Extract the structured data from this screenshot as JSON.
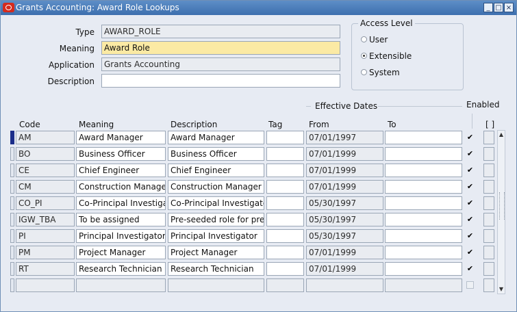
{
  "window": {
    "title": "Grants Accounting: Award Role Lookups",
    "min_label": "_",
    "max_label": "□",
    "close_label": "×"
  },
  "header": {
    "type_label": "Type",
    "type_value": "AWARD_ROLE",
    "meaning_label": "Meaning",
    "meaning_value": "Award Role",
    "application_label": "Application",
    "application_value": "Grants Accounting",
    "description_label": "Description",
    "description_value": ""
  },
  "access_level": {
    "label": "Access Level",
    "options": [
      {
        "label": "User",
        "selected": false
      },
      {
        "label": "Extensible",
        "selected": true
      },
      {
        "label": "System",
        "selected": false
      }
    ]
  },
  "table": {
    "effective_dates_label": "Effective Dates",
    "enabled_label": "Enabled",
    "bracket_label": "[ ]",
    "headers": {
      "code": "Code",
      "meaning": "Meaning",
      "description": "Description",
      "tag": "Tag",
      "from": "From",
      "to": "To"
    },
    "rows": [
      {
        "code": "AM",
        "meaning": "Award Manager",
        "description": "Award Manager",
        "tag": "",
        "from": "07/01/1997",
        "to": "",
        "enabled": true
      },
      {
        "code": "BO",
        "meaning": "Business Officer",
        "description": "Business Officer",
        "tag": "",
        "from": "07/01/1999",
        "to": "",
        "enabled": true
      },
      {
        "code": "CE",
        "meaning": "Chief Engineer",
        "description": "Chief Engineer",
        "tag": "",
        "from": "07/01/1999",
        "to": "",
        "enabled": true
      },
      {
        "code": "CM",
        "meaning": "Construction Manager",
        "description": "Construction Manager",
        "tag": "",
        "from": "07/01/1999",
        "to": "",
        "enabled": true
      },
      {
        "code": "CO_PI",
        "meaning": "Co-Principal Investigat",
        "description": "Co-Principal Investigator",
        "tag": "",
        "from": "05/30/1997",
        "to": "",
        "enabled": true
      },
      {
        "code": "IGW_TBA",
        "meaning": "To be assigned",
        "description": "Pre-seeded role for pre-a",
        "tag": "",
        "from": "05/30/1997",
        "to": "",
        "enabled": true
      },
      {
        "code": "PI",
        "meaning": "Principal Investigator",
        "description": "Principal Investigator",
        "tag": "",
        "from": "05/30/1997",
        "to": "",
        "enabled": true
      },
      {
        "code": "PM",
        "meaning": "Project Manager",
        "description": "Project Manager",
        "tag": "",
        "from": "07/01/1999",
        "to": "",
        "enabled": true
      },
      {
        "code": "RT",
        "meaning": "Research Technician",
        "description": "Research Technician",
        "tag": "",
        "from": "07/01/1999",
        "to": "",
        "enabled": true
      },
      {
        "code": "",
        "meaning": "",
        "description": "",
        "tag": "",
        "from": "",
        "to": "",
        "enabled": false
      }
    ]
  },
  "colors": {
    "title_bar": "#3d6fae",
    "required_field": "#fbeaa4",
    "current_record": "#1c2e8a"
  }
}
